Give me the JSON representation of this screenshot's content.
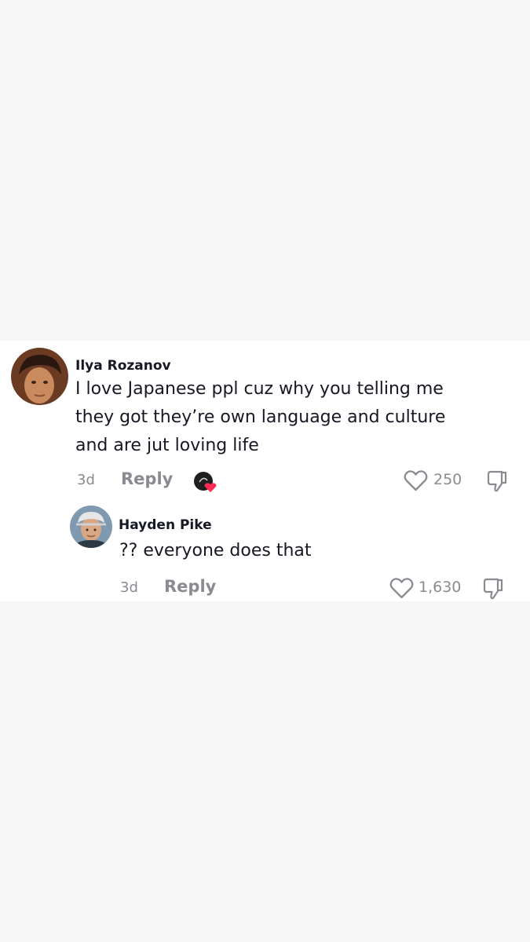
{
  "comments": [
    {
      "username": "Ilya Rozanov",
      "text": "I love Japanese ppl cuz why you telling me\nthey got they’re own language and culture\nand are jut loving life",
      "age": "3d",
      "reply_label": "Reply",
      "like_count": "250",
      "creator_liked": true
    },
    {
      "username": "Hayden Pike",
      "text": "?? everyone does that",
      "age": "3d",
      "reply_label": "Reply",
      "like_count": "1,630",
      "creator_liked": false
    }
  ],
  "icons": {
    "like": "heart-outline-icon",
    "dislike": "thumbs-down-icon",
    "creator_like": "creator-liked-heart-icon"
  },
  "colors": {
    "text_primary": "#161823",
    "text_secondary": "#8a8b91",
    "heart_accent": "#fe2c55",
    "page_background": "#f6f6f6",
    "card_background": "#ffffff"
  }
}
